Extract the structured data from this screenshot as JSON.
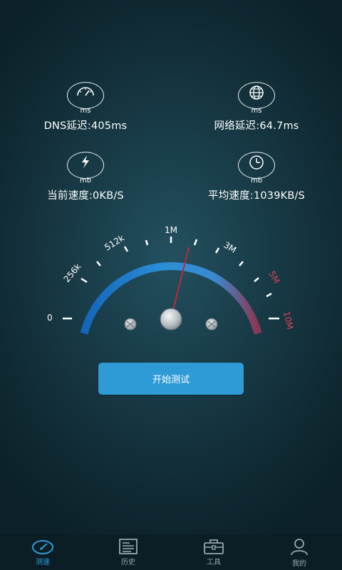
{
  "stats": {
    "dns": {
      "unit": "ms",
      "text": "DNS延迟:405ms",
      "icon": "speedometer-icon"
    },
    "network": {
      "unit": "ms",
      "text": "网络延迟:64.7ms",
      "icon": "globe-icon"
    },
    "current": {
      "unit": "mb",
      "text": "当前速度:0KB/S",
      "icon": "lightning-icon"
    },
    "average": {
      "unit": "mb",
      "text": "平均速度:1039KB/S",
      "icon": "clock-icon"
    }
  },
  "gauge": {
    "labels": [
      "0",
      "256k",
      "512k",
      "1M",
      "3M",
      "5M",
      "10M"
    ],
    "needle_value": "1M+",
    "colors": {
      "arc_start": "#1a7fd0",
      "arc_end": "#9a3a55",
      "needle": "#c0283a",
      "high_label": "#e0444e"
    }
  },
  "start_button": {
    "label": "开始测试"
  },
  "tabs": [
    {
      "label": "测速",
      "icon": "speedometer-icon",
      "active": true
    },
    {
      "label": "历史",
      "icon": "document-icon",
      "active": false
    },
    {
      "label": "工具",
      "icon": "toolbox-icon",
      "active": false
    },
    {
      "label": "我的",
      "icon": "user-icon",
      "active": false
    }
  ],
  "accent_color": "#2e9bd6"
}
